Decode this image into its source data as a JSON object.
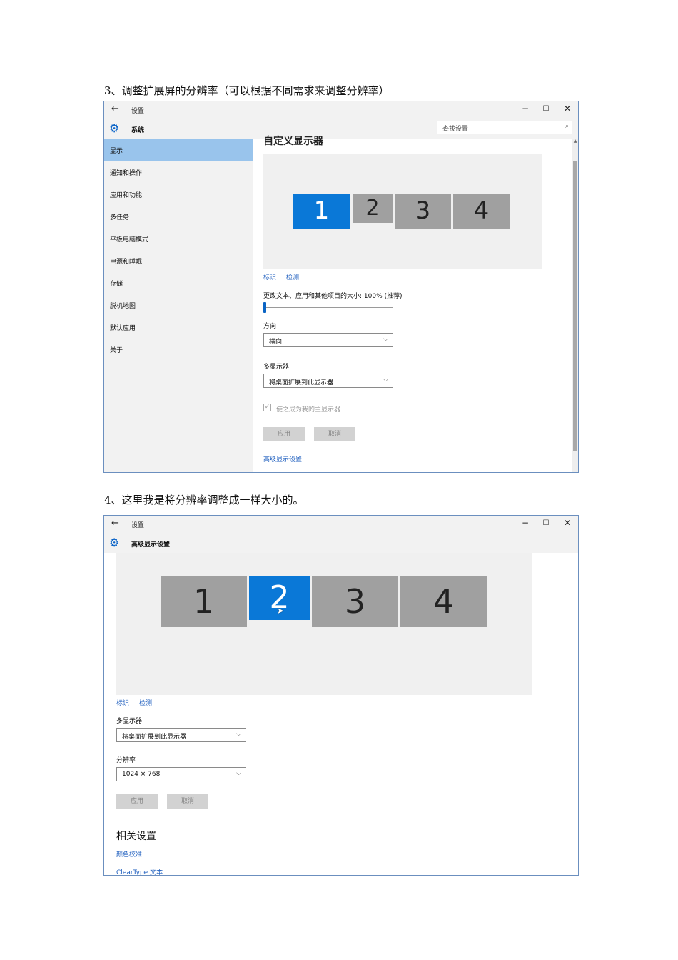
{
  "captions": {
    "step3": "3、调整扩展屏的分辨率（可以根据不同需求来调整分辨率）",
    "step4": "4、这里我是将分辨率调整成一样大小的。"
  },
  "window_common": {
    "back_glyph": "←",
    "app_title": "设置",
    "minimize_glyph": "−",
    "maximize_glyph": "☐",
    "close_glyph": "✕",
    "gear_glyph": "⚙"
  },
  "shot1": {
    "header_title": "系统",
    "search_placeholder": "查找设置",
    "search_glyph": "⌕",
    "sidebar_items": [
      "显示",
      "通知和操作",
      "应用和功能",
      "多任务",
      "平板电脑模式",
      "电源和睡眠",
      "存储",
      "脱机地图",
      "默认应用",
      "关于"
    ],
    "active_sidebar_index": 0,
    "cut_heading": "自定义显示器",
    "monitors": [
      "1",
      "2",
      "3",
      "4"
    ],
    "selected_monitor": "1",
    "identify_link": "标识",
    "detect_link": "检测",
    "scale_label": "更改文本、应用和其他项目的大小: 100% (推荐)",
    "scale_position": 0,
    "orientation_label": "方向",
    "orientation_value": "横向",
    "multi_display_label": "多显示器",
    "multi_display_value": "将桌面扩展到此显示器",
    "main_display_checkbox_label": "使之成为我的主显示器",
    "main_display_checked": true,
    "check_glyph": "✓",
    "apply_button": "应用",
    "cancel_button": "取消",
    "advanced_link": "高级显示设置",
    "dropdown_glyph": "⌵",
    "scroll_up_glyph": "▲"
  },
  "shot2": {
    "header_title": "高级显示设置",
    "monitors": [
      "1",
      "2",
      "3",
      "4"
    ],
    "selected_monitor": "2",
    "identify_link": "标识",
    "detect_link": "检测",
    "multi_display_label": "多显示器",
    "multi_display_value": "将桌面扩展到此显示器",
    "resolution_label": "分辨率",
    "resolution_value": "1024 × 768",
    "apply_button": "应用",
    "cancel_button": "取消",
    "related_settings_title": "相关设置",
    "color_calibration_link": "颜色校准",
    "cleartype_link": "ClearType 文本",
    "dropdown_glyph": "⌵",
    "cursor_glyph": "➤"
  }
}
